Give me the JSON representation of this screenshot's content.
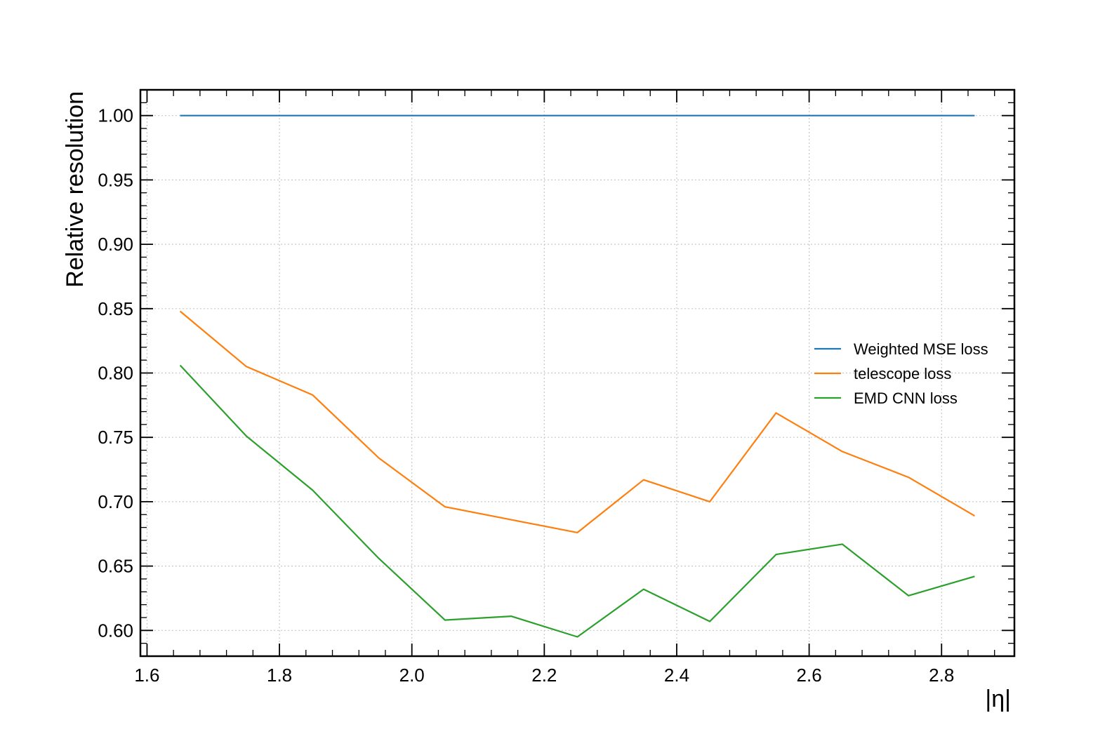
{
  "chart_data": {
    "type": "line",
    "title": "",
    "xlabel": "|η|",
    "ylabel": "Relative resolution",
    "xlim": [
      1.59,
      2.91
    ],
    "ylim": [
      0.58,
      1.02
    ],
    "grid": true,
    "legend_position": "center-right",
    "x_ticks": [
      1.6,
      1.8,
      2.0,
      2.2,
      2.4,
      2.6,
      2.8
    ],
    "x_tick_labels": [
      "1.6",
      "1.8",
      "2.0",
      "2.2",
      "2.4",
      "2.6",
      "2.8"
    ],
    "y_ticks": [
      0.6,
      0.65,
      0.7,
      0.75,
      0.8,
      0.85,
      0.9,
      0.95,
      1.0
    ],
    "y_tick_labels": [
      "0.60",
      "0.65",
      "0.70",
      "0.75",
      "0.80",
      "0.85",
      "0.90",
      "0.95",
      "1.00"
    ],
    "x": [
      1.65,
      1.75,
      1.85,
      1.95,
      2.05,
      2.15,
      2.25,
      2.35,
      2.45,
      2.55,
      2.65,
      2.75,
      2.85
    ],
    "series": [
      {
        "name": "Weighted MSE loss",
        "color": "#1f77b4",
        "values": [
          1.0,
          1.0,
          1.0,
          1.0,
          1.0,
          1.0,
          1.0,
          1.0,
          1.0,
          1.0,
          1.0,
          1.0,
          1.0
        ]
      },
      {
        "name": "telescope loss",
        "color": "#ff7f0e",
        "values": [
          0.848,
          0.805,
          0.783,
          0.734,
          0.696,
          0.686,
          0.676,
          0.717,
          0.7,
          0.769,
          0.739,
          0.719,
          0.689
        ]
      },
      {
        "name": "EMD CNN loss",
        "color": "#2ca02c",
        "values": [
          0.806,
          0.751,
          0.709,
          0.656,
          0.608,
          0.611,
          0.595,
          0.632,
          0.607,
          0.659,
          0.667,
          0.627,
          0.642
        ]
      }
    ]
  }
}
